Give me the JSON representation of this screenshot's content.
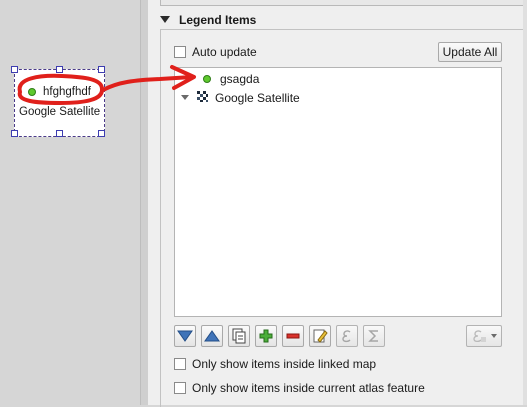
{
  "canvas": {
    "legend_entry_label": "hfghgfhdf",
    "legend_layer_label": "Google Satellite"
  },
  "legend_items_group": {
    "title": "Legend Items",
    "auto_update_label": "Auto update",
    "auto_update_checked": false,
    "update_all_label": "Update All",
    "tree": [
      {
        "label": "gsagda",
        "symbol": "green-point"
      },
      {
        "label": "Google Satellite",
        "symbol": "raster-layer",
        "expanded": true
      }
    ],
    "toolbar_icons": [
      "move-down-icon",
      "move-up-icon",
      "add-group-icon",
      "add-item-icon",
      "remove-item-icon",
      "edit-item-icon",
      "expression-icon",
      "sum-icon",
      "filter-expression-icon"
    ],
    "only_linked_map_label": "Only show items inside linked map",
    "only_atlas_feature_label": "Only show items inside current atlas feature"
  },
  "colors": {
    "annotation_red": "#e0201b",
    "symbol_green": "#5fc92e",
    "frame_border": "#4a3a88"
  }
}
